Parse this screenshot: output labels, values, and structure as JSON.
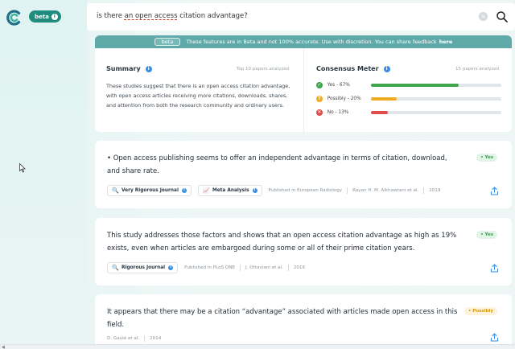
{
  "app": {
    "beta_label": "beta",
    "beta_info": "i"
  },
  "search": {
    "query_pre": "is there ",
    "query_misspelled": "an open access",
    "query_post": " citation advantage?",
    "clear_icon": "close-icon",
    "search_icon": "search-icon"
  },
  "banner": {
    "tag": "beta",
    "text": "These features are in Beta and not 100% accurate. Use with discretion. You can share feedback",
    "link": "here"
  },
  "summary": {
    "title": "Summary",
    "papers_note": "Top 10 papers analyzed",
    "text": "These studies suggest that there is an open access citation advantage, with open access articles receiving more citations, downloads, shares, and attention from both the research community and ordinary users."
  },
  "meter": {
    "title": "Consensus Meter",
    "papers_note": "15 papers analyzed",
    "rows": [
      {
        "label": "Yes - 67%",
        "glyph": "✓",
        "color": "#3fa64c",
        "value": 0.67
      },
      {
        "label": "Possibly - 20%",
        "glyph": "?",
        "color": "#f0ab1e",
        "value": 0.2
      },
      {
        "label": "No - 13%",
        "glyph": "✕",
        "color": "#e04b4b",
        "value": 0.13
      }
    ]
  },
  "results": [
    {
      "text": "• Open access publishing seems to offer an independent advantage in terms of citation, download, and share rate.",
      "verdict": "• Yes",
      "chips": [
        {
          "label": "Very Rigorous Journal",
          "icon": "🔍"
        },
        {
          "label": "Meta Analysis",
          "icon": "📈"
        }
      ],
      "meta": [
        "Published in European Radiology",
        "Rayan H. M. Alkhawtani et al.",
        "2019"
      ]
    },
    {
      "text": "This study addresses those factors and shows that an open access citation advantage as high as 19% exists, even when articles are embargoed during some or all of their prime citation years.",
      "verdict": "• Yes",
      "chips": [
        {
          "label": "Rigorous Journal",
          "icon": "🔍"
        }
      ],
      "meta": [
        "Published in PLoS ONE",
        "J. Ottaviani et al.",
        "2016"
      ]
    },
    {
      "text": "It appears that there may be a citation “advantage” associated with articles made open access in this field.",
      "verdict": "• Possibly",
      "chips": [],
      "meta": [
        "D. Gaulé et al.",
        "2014"
      ]
    }
  ]
}
